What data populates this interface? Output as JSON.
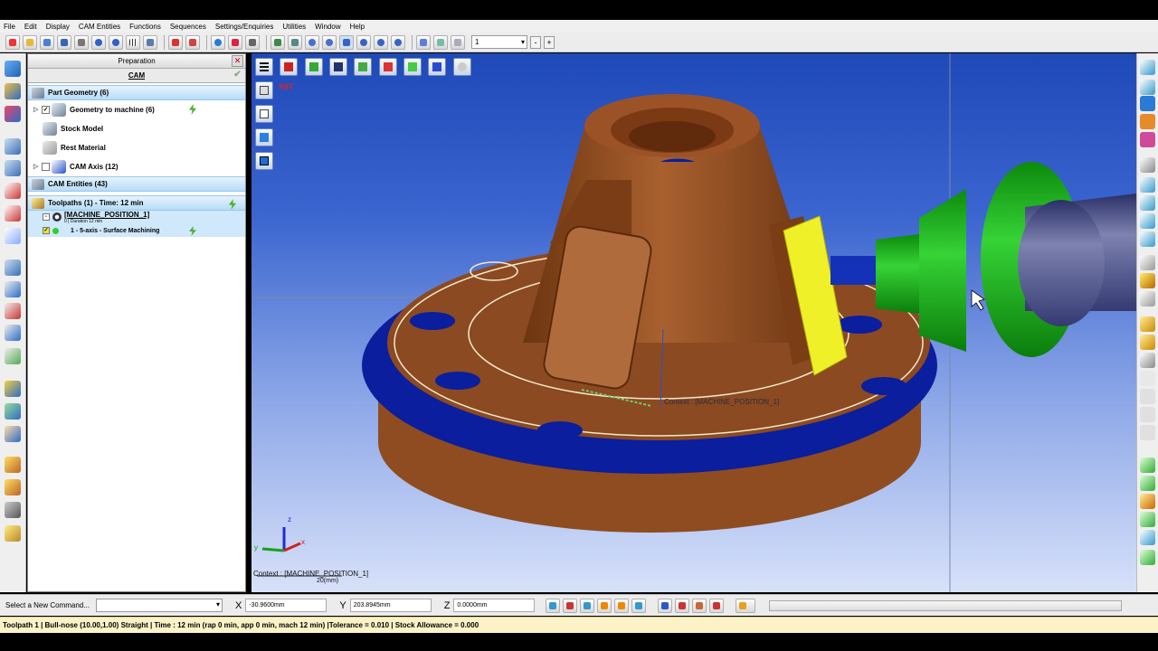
{
  "menu": [
    "File",
    "Edit",
    "Display",
    "CAM Entities",
    "Functions",
    "Sequences",
    "Settings/Enquiries",
    "Utilities",
    "Window",
    "Help"
  ],
  "toolbar": {
    "layer_value": "1",
    "minus_label": "-",
    "plus_label": "+"
  },
  "panel": {
    "title": "Preparation",
    "close_label": "✕",
    "tab_label": "CAM",
    "part_geometry": "Part Geometry (6)",
    "geometry_to_machine": "Geometry to machine (6)",
    "stock_model": "Stock Model",
    "rest_material": "Rest Material",
    "cam_axis": "CAM Axis (12)",
    "cam_entities": "CAM Entities (43)",
    "toolpaths": "Toolpaths (1) - Time: 12 min",
    "machine_position": "[MACHINE_POSITION_1]",
    "duration": "0 | Duration 12 min",
    "operation": "1 - 5-axis - Surface Machining"
  },
  "viewport": {
    "context_label": "Context : [MACHINE_POSITION_1]",
    "context_bottom": "Context : [MACHINE_POSITION_1]",
    "scale_label": "20(mm)",
    "axis_x": "x",
    "axis_y": "y",
    "axis_z": "z",
    "triad_label": "xyz"
  },
  "command": {
    "label": "Select a New Command...",
    "value": ""
  },
  "coords": {
    "x_label": "X",
    "x": "-30.9600mm",
    "y_label": "Y",
    "y": "203.8945mm",
    "z_label": "Z",
    "z": "0.0000mm"
  },
  "status": "Toolpath 1 | Bull-nose (10.00,1.00) Straight | Time : 12 min (rap 0 min, app 0 min, mach 12 min) |Tolerance = 0.010 | Stock Allowance = 0.000",
  "colors": {
    "part": "#8b4a22",
    "flange_edge": "#0a1e9e",
    "tool_holder": "#19b51a",
    "highlight": "#f0f028",
    "status_bg": "#fbf2c7"
  }
}
